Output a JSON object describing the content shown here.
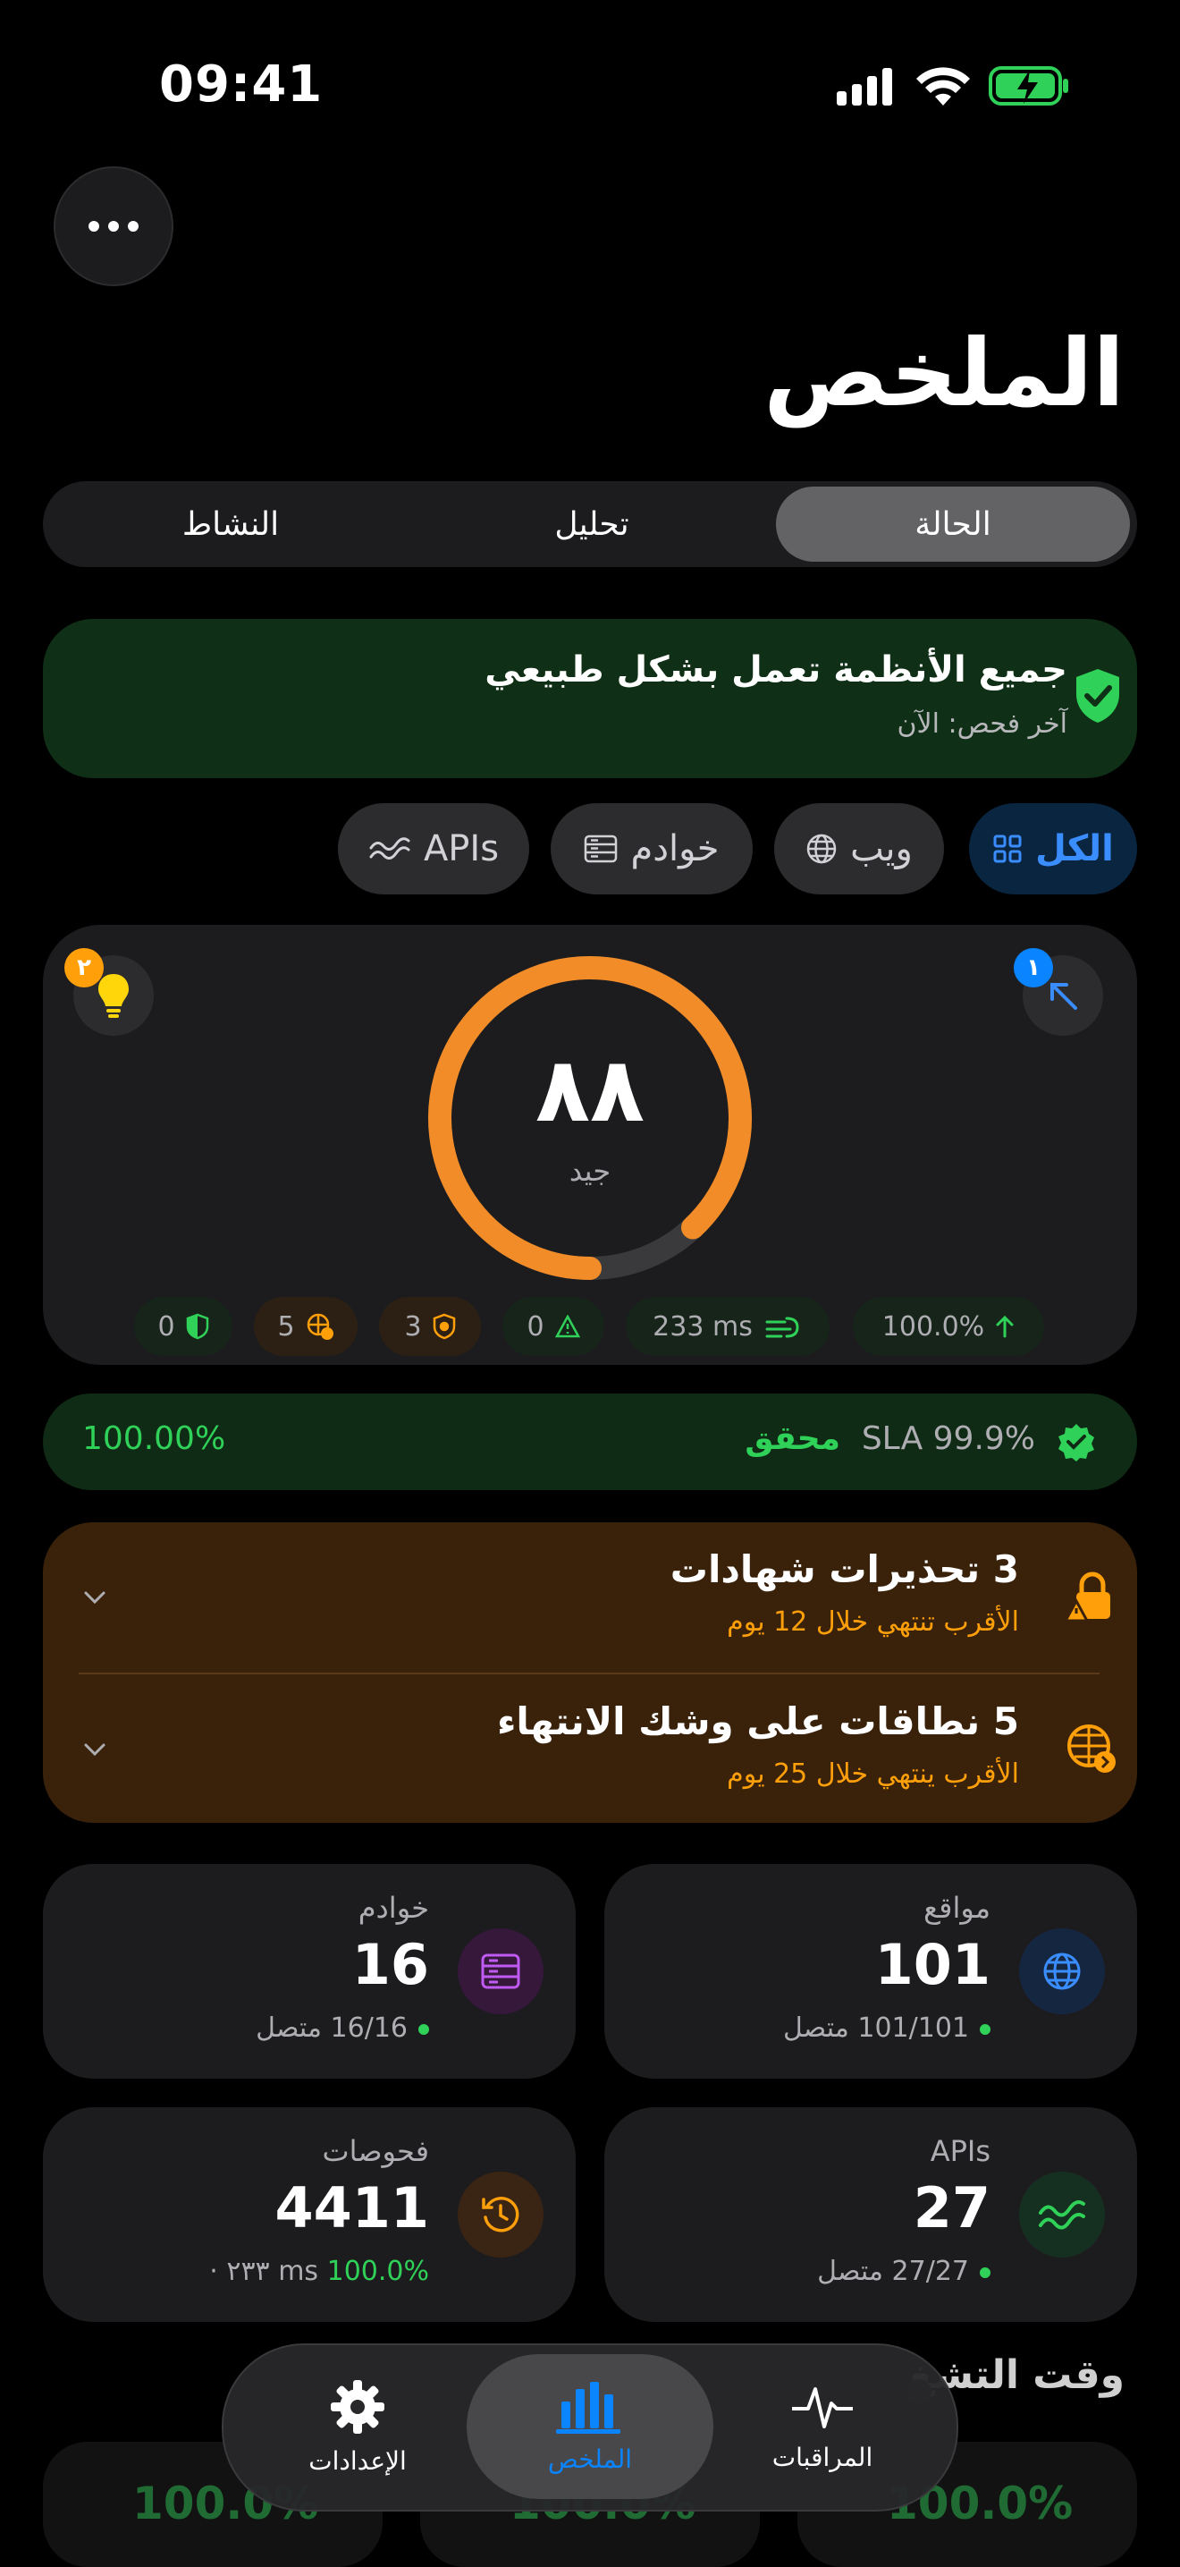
{
  "status_bar": {
    "time": "09:41"
  },
  "title": "الملخص",
  "segments": [
    {
      "label": "الحالة",
      "active": true
    },
    {
      "label": "تحليل",
      "active": false
    },
    {
      "label": "النشاط",
      "active": false
    }
  ],
  "banner": {
    "title": "جميع الأنظمة تعمل بشكل طبيعي",
    "subtitle": "آخر فحص: الآن",
    "color": "#30d158"
  },
  "filters": [
    {
      "label": "الكل",
      "icon": "grid-icon",
      "active": true
    },
    {
      "label": "ويب",
      "icon": "globe-icon",
      "active": false
    },
    {
      "label": "خوادم",
      "icon": "server-icon",
      "active": false
    },
    {
      "label": "APIs",
      "icon": "api-wave-icon",
      "active": false
    }
  ],
  "score": {
    "value": "٨٨",
    "label": "جيد",
    "fraction": 0.88,
    "color": "#f28c28",
    "left_badge": "٢",
    "right_badge": "١"
  },
  "pills": [
    {
      "value": "100.0%",
      "icon": "arrow-up-icon",
      "color": "#30d158"
    },
    {
      "value": "233 ms",
      "icon": "speed-icon",
      "color": "#30d158"
    },
    {
      "value": "0",
      "icon": "alert-triangle-icon",
      "color": "#30d158"
    },
    {
      "value": "3",
      "icon": "badge-shield-icon",
      "color": "#ff9f0a"
    },
    {
      "value": "5",
      "icon": "globe-clock-icon",
      "color": "#ff9f0a"
    },
    {
      "value": "0",
      "icon": "shield-half-icon",
      "color": "#30d158"
    }
  ],
  "sla": {
    "label": "SLA 99.9%",
    "status": "محقق",
    "value": "100.00%"
  },
  "warnings": [
    {
      "title": "3 تحذيرات شهادات",
      "subtitle": "الأقرب تنتهي خلال 12 يوم"
    },
    {
      "title": "5 نطاقات على وشك الانتهاء",
      "subtitle": "الأقرب ينتهي خلال 25 يوم"
    }
  ],
  "stats": {
    "sites": {
      "label": "مواقع",
      "value": "101",
      "sub": "101/101 متصل"
    },
    "servers": {
      "label": "خوادم",
      "value": "16",
      "sub": "16/16 متصل"
    },
    "apis": {
      "label": "APIs",
      "value": "27",
      "sub": "27/27 متصل"
    },
    "checks": {
      "label": "فحوصات",
      "value": "4411",
      "sub_ms": "٢٣٣ ms",
      "sub_pct": "100.0%"
    }
  },
  "uptime": {
    "title": "وقت التشغ",
    "values": [
      "100.0%",
      "100.0%",
      "100.0%"
    ]
  },
  "tabs": [
    {
      "label": "المراقبات",
      "icon": "pulse-icon",
      "active": false
    },
    {
      "label": "الملخص",
      "icon": "chart-bars-icon",
      "active": true
    },
    {
      "label": "الإعدادات",
      "icon": "gear-icon",
      "active": false
    }
  ]
}
